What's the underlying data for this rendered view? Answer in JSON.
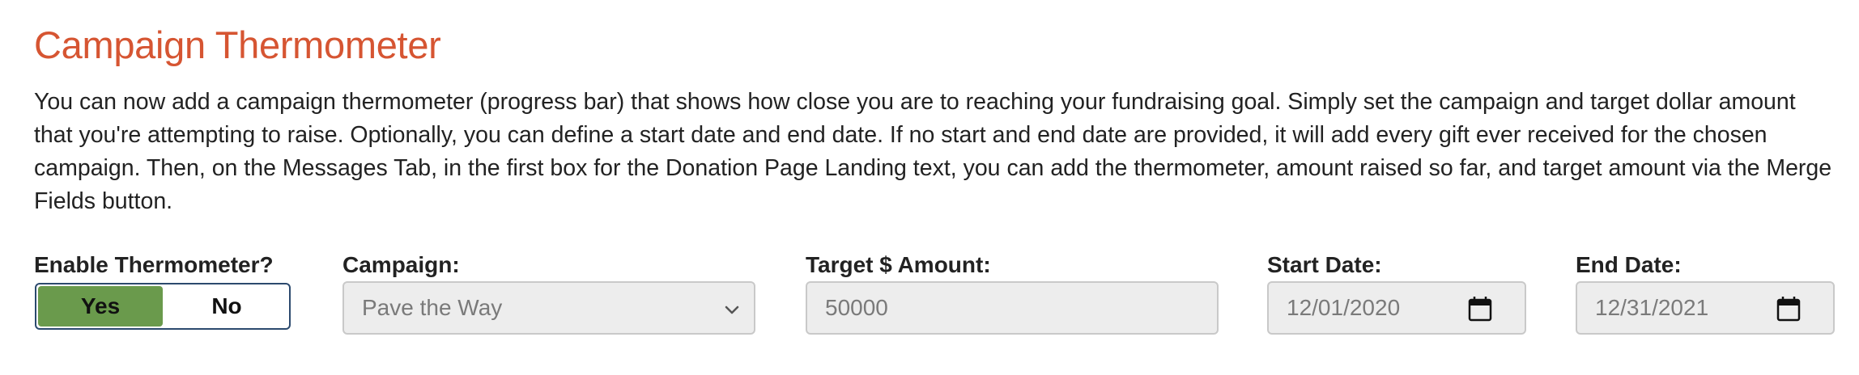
{
  "section": {
    "title": "Campaign Thermometer",
    "description": "You can now add a campaign thermometer (progress bar) that shows how close you are to reaching your fundraising goal. Simply set the campaign and target dollar amount that you're attempting to raise. Optionally, you can define a start date and end date. If no start and end date are provided, it will add every gift ever received for the chosen campaign. Then, on the Messages Tab, in the first box for the Donation Page Landing text, you can add the thermometer, amount raised so far, and target amount via the Merge Fields button."
  },
  "enable": {
    "label": "Enable Thermometer?",
    "yes_label": "Yes",
    "no_label": "No",
    "selected": "Yes",
    "active_color": "#6a9a4c"
  },
  "campaign": {
    "label": "Campaign:",
    "value": "Pave the Way",
    "icon": "chevron-down-icon"
  },
  "target": {
    "label": "Target $ Amount:",
    "value": "50000"
  },
  "start_date": {
    "label": "Start Date:",
    "value": "12/01/2020",
    "icon": "calendar-icon"
  },
  "end_date": {
    "label": "End Date:",
    "value": "12/31/2021",
    "icon": "calendar-icon"
  },
  "colors": {
    "title": "#d65532",
    "field_bg": "#ededed"
  }
}
